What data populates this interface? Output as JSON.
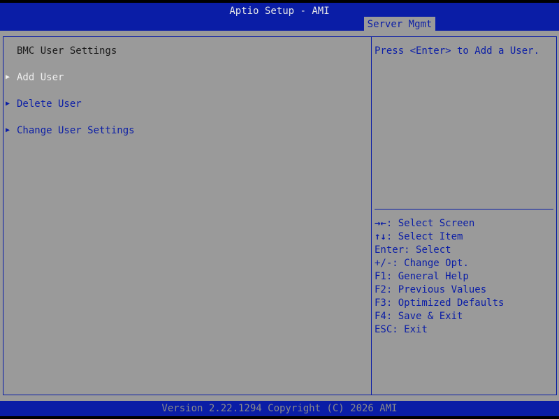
{
  "header": {
    "title": "Aptio Setup - AMI",
    "active_tab": "Server Mgmt"
  },
  "left": {
    "section_title": "BMC User Settings",
    "items": [
      {
        "label": "Add User",
        "selected": true
      },
      {
        "label": "Delete User",
        "selected": false
      },
      {
        "label": "Change User Settings",
        "selected": false
      }
    ],
    "arrow_glyph": "▶"
  },
  "right": {
    "help": "Press <Enter> to Add a User.",
    "keys": [
      {
        "key": "→←",
        "desc": ": Select Screen"
      },
      {
        "key": "↑↓",
        "desc": ": Select Item"
      },
      {
        "key": "Enter",
        "desc": ": Select"
      },
      {
        "key": "+/-",
        "desc": ": Change Opt."
      },
      {
        "key": "F1",
        "desc": ": General Help"
      },
      {
        "key": "F2",
        "desc": ": Previous Values"
      },
      {
        "key": "F3",
        "desc": ": Optimized Defaults"
      },
      {
        "key": "F4",
        "desc": ": Save & Exit"
      },
      {
        "key": "ESC",
        "desc": ": Exit"
      }
    ]
  },
  "footer": {
    "text": "Version 2.22.1294 Copyright (C) 2026 AMI"
  },
  "colors": {
    "bar": "#0a1da6",
    "panel": "#9a9a9a",
    "selected_text": "#f0f0f0",
    "normal_text": "#0a1da6"
  }
}
